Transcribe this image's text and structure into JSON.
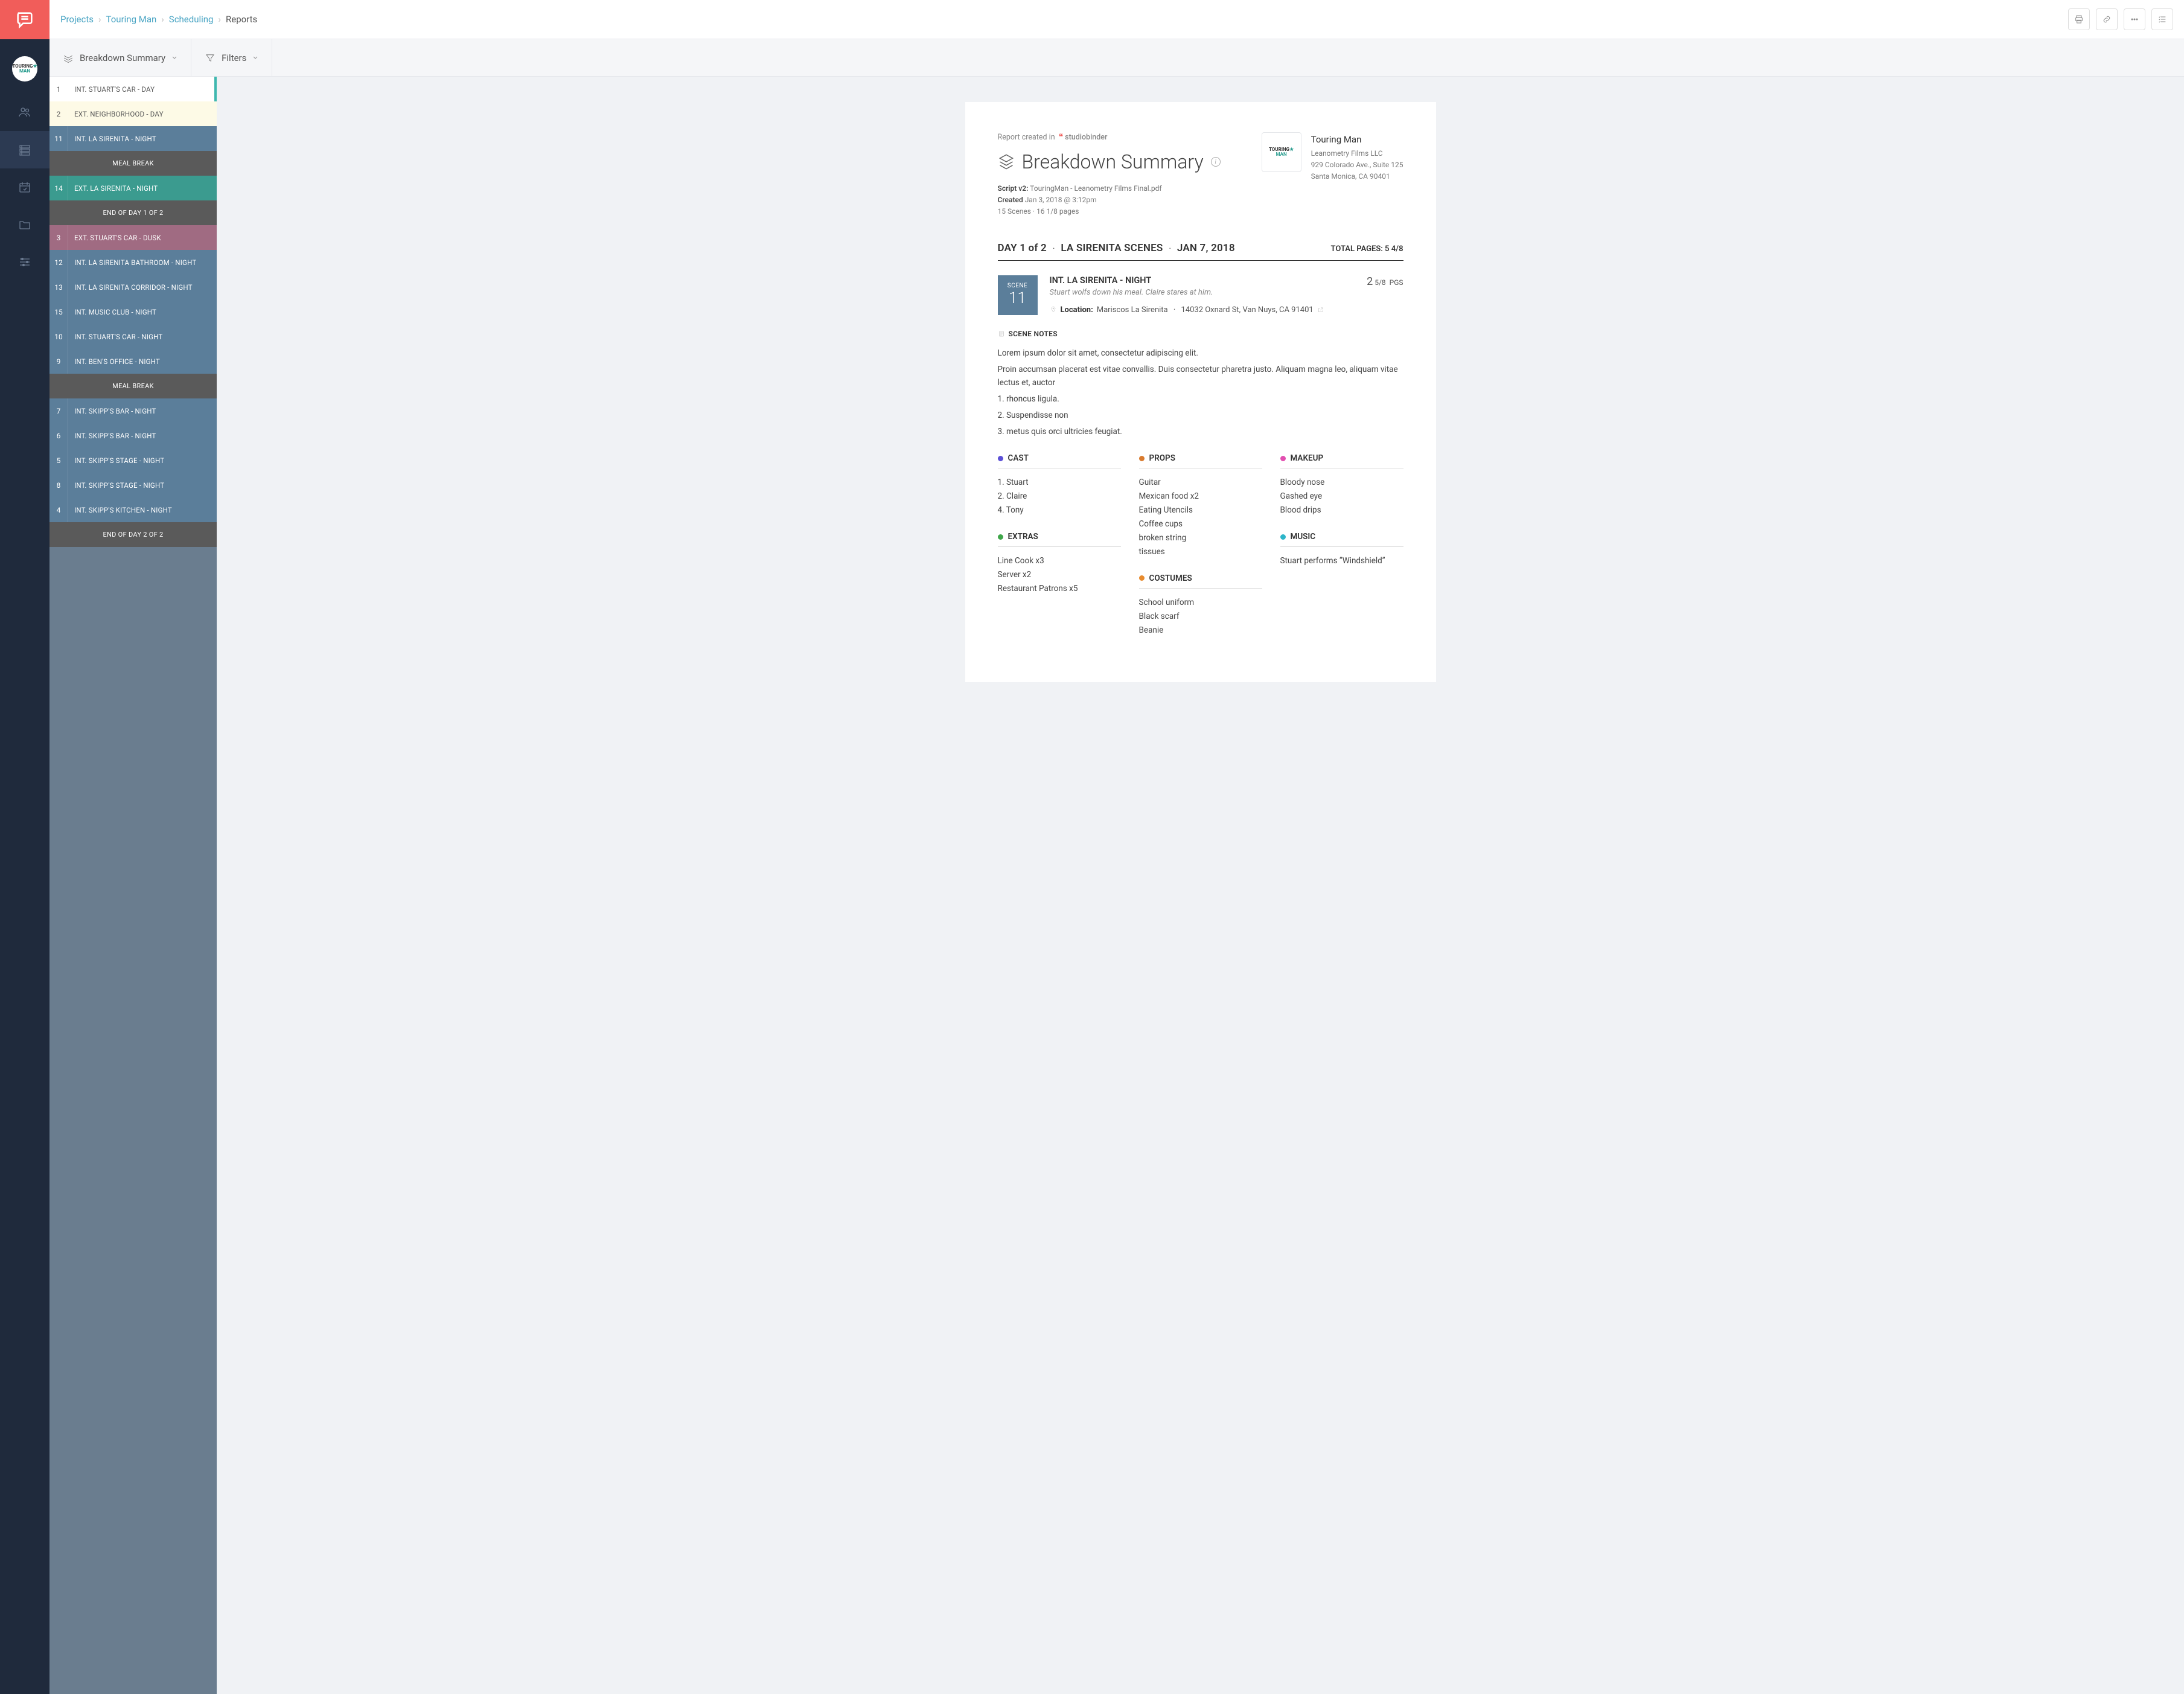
{
  "breadcrumbs": [
    "Projects",
    "Touring Man",
    "Scheduling",
    "Reports"
  ],
  "filters": {
    "breakdown": "Breakdown Summary",
    "filters": "Filters"
  },
  "scenes": [
    {
      "num": "1",
      "label": "INT. STUART'S CAR - DAY",
      "cls": "white active"
    },
    {
      "num": "2",
      "label": "EXT. NEIGHBORHOOD - DAY",
      "cls": "cream"
    },
    {
      "num": "11",
      "label": "INT. LA SIRENITA - NIGHT",
      "cls": "blue"
    },
    {
      "banner": "MEAL BREAK"
    },
    {
      "num": "14",
      "label": "EXT. LA SIRENITA - NIGHT",
      "cls": "teal"
    },
    {
      "banner": "END OF DAY 1 OF 2"
    },
    {
      "num": "3",
      "label": "EXT. STUART'S CAR - DUSK",
      "cls": "purple"
    },
    {
      "num": "12",
      "label": "INT. LA SIRENITA BATHROOM - NIGHT",
      "cls": "blue"
    },
    {
      "num": "13",
      "label": "INT. LA SIRENITA CORRIDOR - NIGHT",
      "cls": "blue"
    },
    {
      "num": "15",
      "label": "INT. MUSIC CLUB - NIGHT",
      "cls": "blue"
    },
    {
      "num": "10",
      "label": "INT. STUART'S CAR - NIGHT",
      "cls": "blue"
    },
    {
      "num": "9",
      "label": "INT. BEN'S OFFICE - NIGHT",
      "cls": "blue"
    },
    {
      "banner": "MEAL BREAK"
    },
    {
      "num": "7",
      "label": "INT. SKIPP'S BAR - NIGHT",
      "cls": "blue"
    },
    {
      "num": "6",
      "label": "INT. SKIPP'S BAR - NIGHT",
      "cls": "blue"
    },
    {
      "num": "5",
      "label": "INT. SKIPP'S STAGE - NIGHT",
      "cls": "blue"
    },
    {
      "num": "8",
      "label": "INT. SKIPP'S STAGE - NIGHT",
      "cls": "blue"
    },
    {
      "num": "4",
      "label": "INT. SKIPP'S KITCHEN - NIGHT",
      "cls": "blue"
    },
    {
      "banner": "END OF DAY 2 OF 2"
    }
  ],
  "report": {
    "created_in": "Report created in",
    "brand": "studiobinder",
    "title": "Breakdown Summary",
    "script_lbl": "Script v2:",
    "script_val": "TouringMan - Leanometry Films Final.pdf",
    "created_lbl": "Created",
    "created_val": "Jan 3, 2018 @ 3:12pm",
    "stats": "15 Scenes   ·   16 1/8 pages",
    "project": {
      "name": "Touring Man",
      "company": "Leanometry Films LLC",
      "addr1": "929 Colorado Ave., Suite 125",
      "addr2": "Santa Monica, CA 90401"
    },
    "day": {
      "p1": "DAY 1 of 2",
      "p2": "LA SIRENITA SCENES",
      "p3": "JAN 7, 2018",
      "totalpgs": "TOTAL PAGES: 5 4/8"
    },
    "scene": {
      "badge_lbl": "SCENE",
      "badge_num": "11",
      "title": "INT. LA SIRENITA - NIGHT",
      "desc": "Stuart wolfs down his meal. Claire stares at him.",
      "pgs_big": "2",
      "pgs_frac": "5/8",
      "pgs_sfx": "PGS",
      "loc_lbl": "Location:",
      "loc_name": "Mariscos La Sirenita",
      "loc_addr": "14032 Oxnard St, Van Nuys, CA 91401"
    },
    "notes_hdr": "SCENE NOTES",
    "notes": [
      "Lorem ipsum dolor sit amet, consectetur adipiscing elit.",
      "Proin accumsan placerat est vitae convallis. Duis consectetur pharetra justo. Aliquam magna leo, aliquam vitae lectus et, auctor",
      "1. rhoncus ligula.",
      "2. Suspendisse non",
      "3.  metus quis orci ultricies feugiat."
    ],
    "cats": {
      "cast": {
        "label": "CAST",
        "color": "#5b4fd6",
        "items": [
          "1. Stuart",
          "2. Claire",
          "4. Tony"
        ]
      },
      "extras": {
        "label": "EXTRAS",
        "color": "#3fa64a",
        "items": [
          "Line Cook x3",
          "Server x2",
          "Restaurant Patrons x5"
        ]
      },
      "props": {
        "label": "PROPS",
        "color": "#d97b2e",
        "items": [
          "Guitar",
          "Mexican food x2",
          "Eating Utencils",
          "Coffee cups",
          "broken string",
          "tissues"
        ]
      },
      "costumes": {
        "label": "COSTUMES",
        "color": "#e88b2e",
        "items": [
          "School uniform",
          "Black scarf",
          "Beanie"
        ]
      },
      "makeup": {
        "label": "MAKEUP",
        "color": "#e24fb0",
        "items": [
          "Bloody nose",
          "Gashed eye",
          "Blood drips"
        ]
      },
      "music": {
        "label": "MUSIC",
        "color": "#2db5c9",
        "items": [
          "Stuart performs “Windshield”"
        ]
      }
    }
  }
}
